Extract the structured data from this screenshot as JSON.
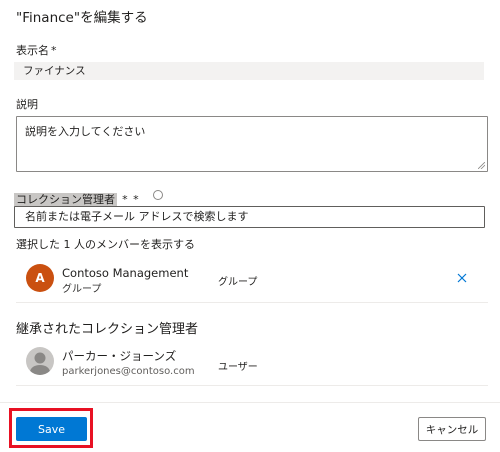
{
  "panel": {
    "title": "\"Finance\"を編集する"
  },
  "display_name": {
    "label": "表示名",
    "required_marker": "*",
    "value": "ファイナンス"
  },
  "description": {
    "label": "説明",
    "placeholder": "説明を入力してください"
  },
  "collection_admins": {
    "label": "コレクション管理者",
    "required_marker": "* *",
    "info_icon": "info-icon",
    "search_placeholder": "名前または電子メール アドレスで検索します",
    "show_members_text": "選択した 1 人のメンバーを表示する",
    "members": [
      {
        "initial": "A",
        "name": "Contoso Management",
        "subtitle": "グループ",
        "type": "グループ",
        "avatar_color": "#ca5010",
        "remove_icon": "close-icon"
      }
    ]
  },
  "inherited_admins": {
    "heading": "継承されたコレクション管理者",
    "members": [
      {
        "name": "パーカー・ジョーンズ",
        "email": "parkerjones@contoso.com",
        "type": "ユーザー",
        "avatar_icon": "person-icon"
      }
    ]
  },
  "footer": {
    "save_label": "Save",
    "cancel_label": "キャンセル",
    "primary_color": "#0078d4",
    "highlight_color": "#e81123"
  }
}
